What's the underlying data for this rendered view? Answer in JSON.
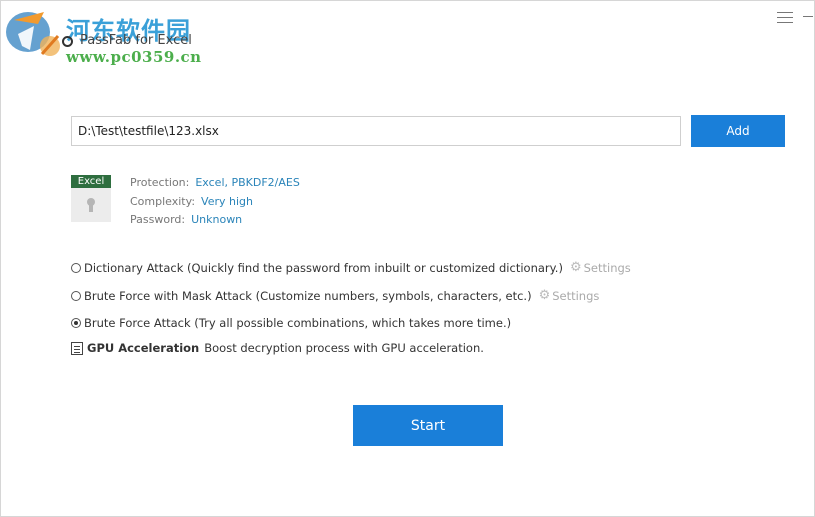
{
  "watermark": {
    "site_name": "河东软件园",
    "url": "www.pc0359.cn"
  },
  "window": {
    "title": "PassFab for Excel",
    "menu_icon": "hamburger-menu-icon",
    "minimize_icon": "minimize-icon"
  },
  "file": {
    "path": "D:\\Test\\testfile\\123.xlsx",
    "add_label": "Add"
  },
  "file_info": {
    "badge": "Excel",
    "protection_label": "Protection:",
    "protection_value": "Excel, PBKDF2/AES",
    "complexity_label": "Complexity:",
    "complexity_value": "Very high",
    "password_label": "Password:",
    "password_value": "Unknown"
  },
  "attacks": [
    {
      "label": "Dictionary Attack (Quickly find the password from inbuilt or customized dictionary.)",
      "settings": "Settings",
      "selected": false
    },
    {
      "label": "Brute Force with Mask Attack (Customize numbers, symbols, characters, etc.)",
      "settings": "Settings",
      "selected": false
    },
    {
      "label": "Brute Force Attack (Try all possible combinations, which takes more time.)",
      "selected": true
    }
  ],
  "gpu": {
    "title": "GPU Acceleration",
    "description": "Boost decryption process with GPU acceleration."
  },
  "start_label": "Start",
  "colors": {
    "accent": "#1a7fd9",
    "link": "#2a84b9",
    "excel_badge": "#2e6e3f"
  }
}
